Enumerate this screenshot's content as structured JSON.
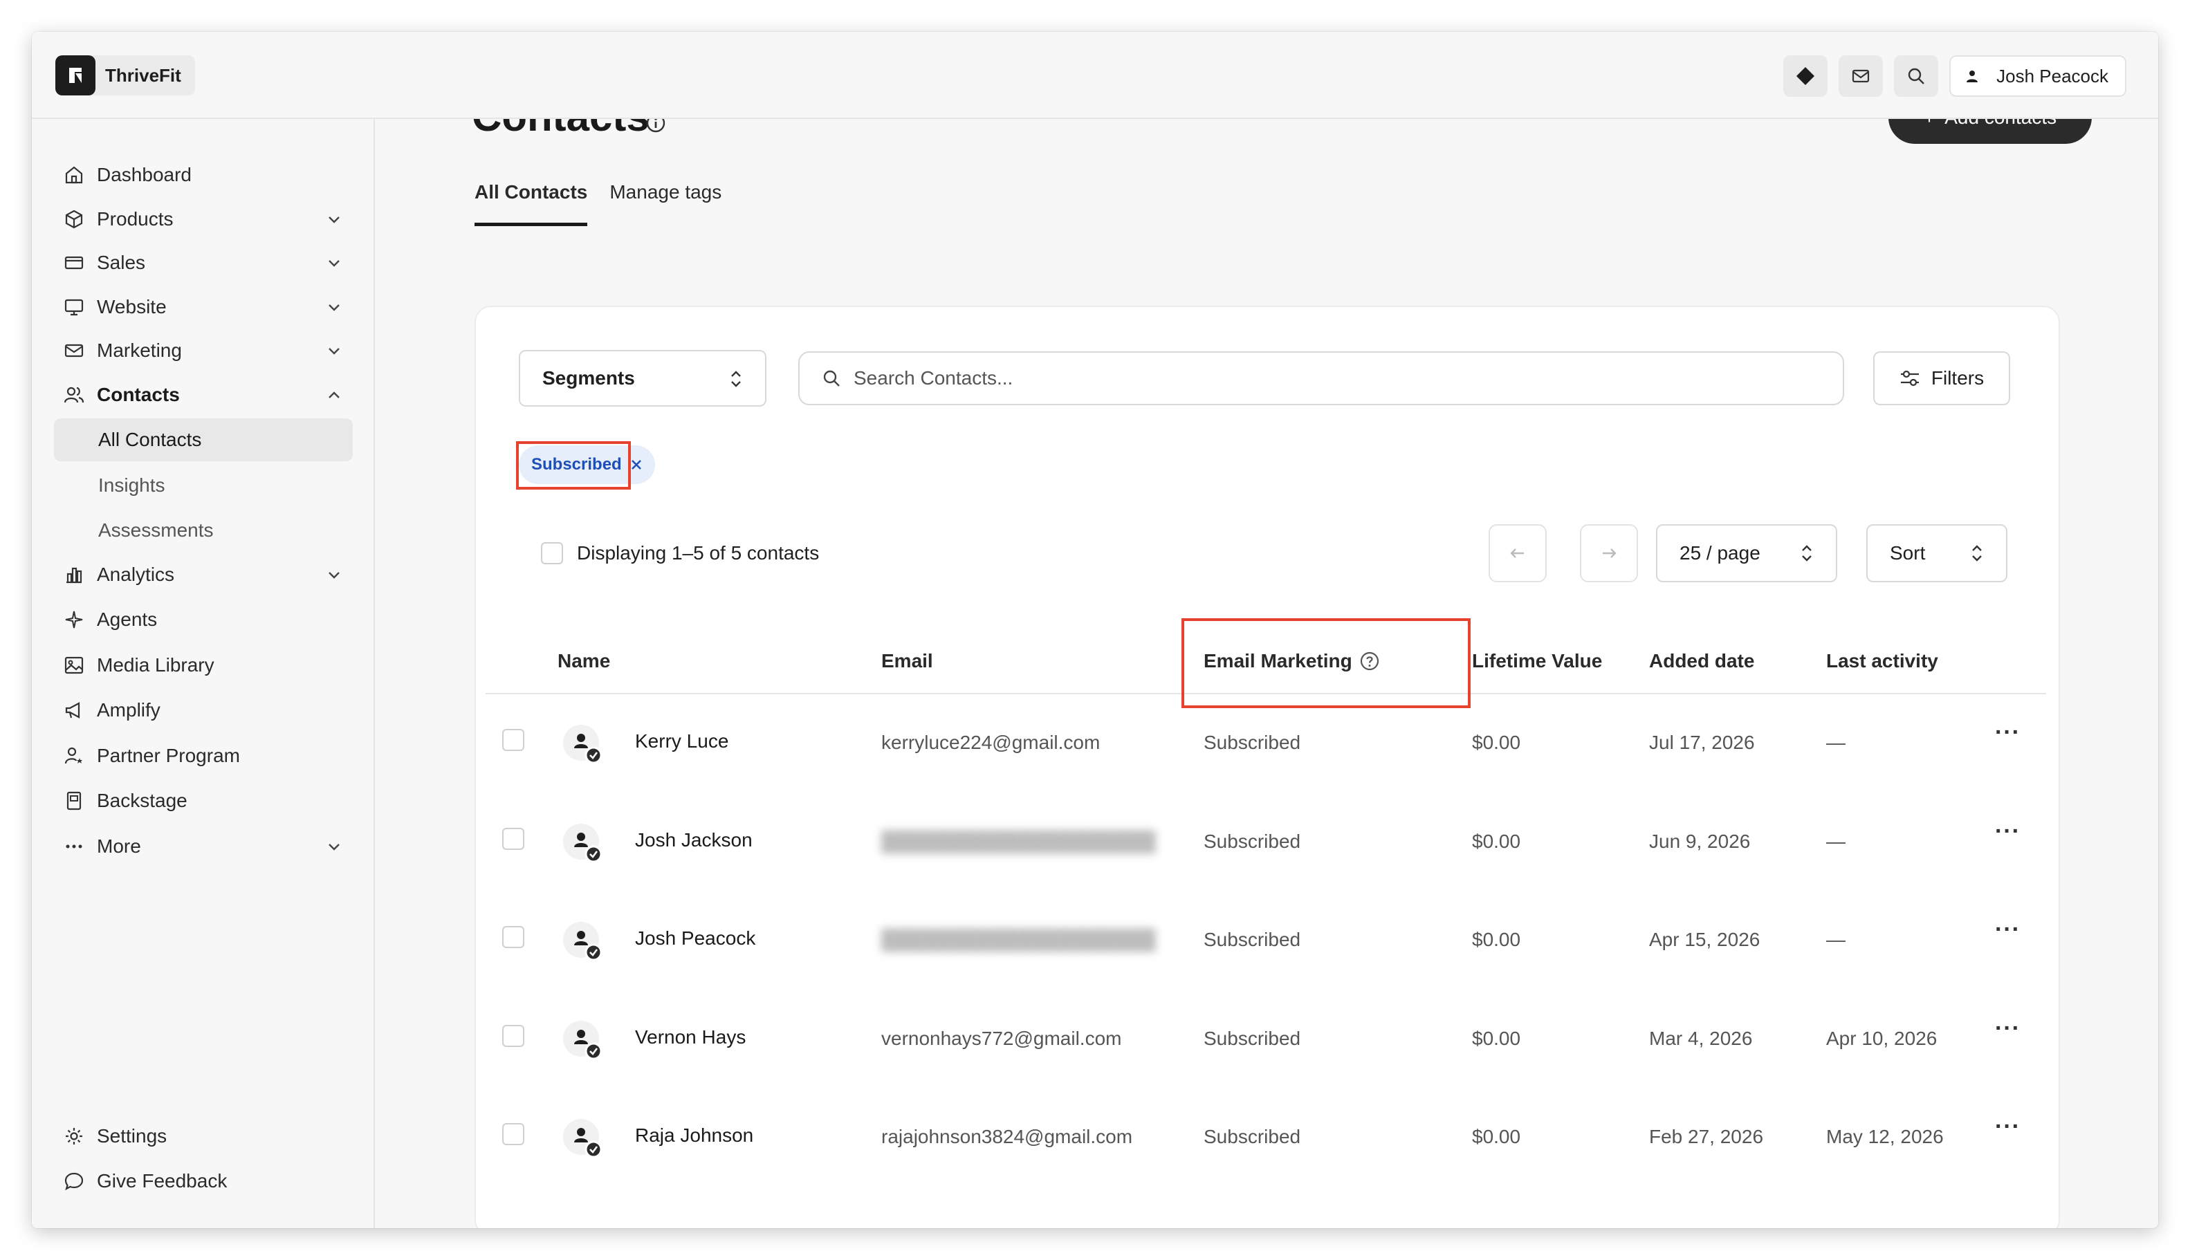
{
  "app": {
    "name": "ThriveFit"
  },
  "topbar": {
    "user_name": "Josh Peacock"
  },
  "sidebar": {
    "items": [
      {
        "label": "Dashboard",
        "icon": "home-icon",
        "chevron": false
      },
      {
        "label": "Products",
        "icon": "box-icon",
        "chevron": true
      },
      {
        "label": "Sales",
        "icon": "card-icon",
        "chevron": true
      },
      {
        "label": "Website",
        "icon": "monitor-icon",
        "chevron": true
      },
      {
        "label": "Marketing",
        "icon": "mail-icon",
        "chevron": true
      },
      {
        "label": "Contacts",
        "icon": "users-icon",
        "chevron": true,
        "expanded": true
      }
    ],
    "sub_items": [
      {
        "label": "All Contacts",
        "active": true
      },
      {
        "label": "Insights",
        "active": false
      },
      {
        "label": "Assessments",
        "active": false
      }
    ],
    "items_after": [
      {
        "label": "Analytics",
        "icon": "chart-icon",
        "chevron": true
      },
      {
        "label": "Agents",
        "icon": "sparkle-icon",
        "chevron": false
      },
      {
        "label": "Media Library",
        "icon": "image-icon",
        "chevron": false
      },
      {
        "label": "Amplify",
        "icon": "megaphone-icon",
        "chevron": false
      },
      {
        "label": "Partner Program",
        "icon": "partner-icon",
        "chevron": false
      },
      {
        "label": "Backstage",
        "icon": "backstage-icon",
        "chevron": false
      },
      {
        "label": "More",
        "icon": "ellipsis-icon",
        "chevron": true
      }
    ],
    "footer": [
      {
        "label": "Settings",
        "icon": "gear-icon"
      },
      {
        "label": "Give Feedback",
        "icon": "chat-bubble-icon"
      }
    ]
  },
  "page": {
    "title": "Contacts",
    "add_button": "Add contacts",
    "tabs": [
      {
        "label": "All Contacts",
        "active": true
      },
      {
        "label": "Manage tags",
        "active": false
      }
    ]
  },
  "toolbar": {
    "segments_label": "Segments",
    "search_placeholder": "Search Contacts...",
    "filters_label": "Filters",
    "chip_label": "Subscribed",
    "displaying": "Displaying 1–5 of 5 contacts",
    "per_page": "25 / page",
    "sort_label": "Sort"
  },
  "table": {
    "headers": [
      "Name",
      "Email",
      "Email Marketing",
      "Lifetime Value",
      "Added date",
      "Last activity"
    ],
    "rows": [
      {
        "name": "Kerry Luce",
        "email": "kerryluce224@gmail.com",
        "blurred": false,
        "status": "Subscribed",
        "value": "$0.00",
        "added": "Jul 17, 2026",
        "last": "—"
      },
      {
        "name": "Josh Jackson",
        "email": "",
        "blurred": true,
        "status": "Subscribed",
        "value": "$0.00",
        "added": "Jun 9, 2026",
        "last": "—"
      },
      {
        "name": "Josh Peacock",
        "email": "",
        "blurred": true,
        "status": "Subscribed",
        "value": "$0.00",
        "added": "Apr 15, 2026",
        "last": "—"
      },
      {
        "name": "Vernon Hays",
        "email": "vernonhays772@gmail.com",
        "blurred": false,
        "status": "Subscribed",
        "value": "$0.00",
        "added": "Mar 4, 2026",
        "last": "Apr 10, 2026"
      },
      {
        "name": "Raja Johnson",
        "email": "rajajohnson3824@gmail.com",
        "blurred": false,
        "status": "Subscribed",
        "value": "$0.00",
        "added": "Feb 27, 2026",
        "last": "May 12, 2026"
      }
    ],
    "more_symbol": "···"
  },
  "colors": {
    "accent_dark": "#2b2b2b",
    "chip_bg": "#e6eefc",
    "chip_text": "#1f4fb5",
    "highlight": "#e5432d"
  }
}
